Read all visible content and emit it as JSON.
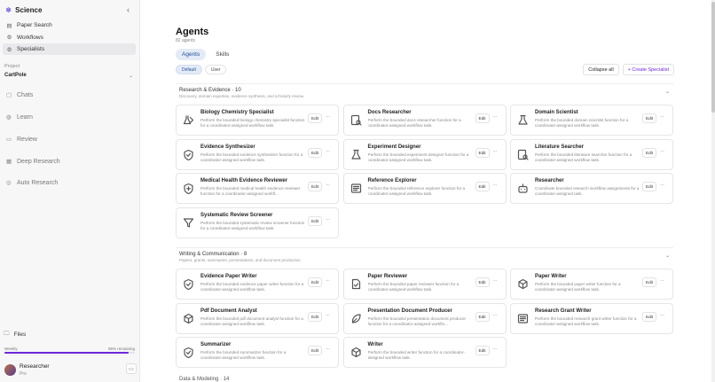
{
  "brand": {
    "name": "Science"
  },
  "nav": [
    {
      "label": "Paper Search",
      "icon": "document-icon"
    },
    {
      "label": "Workflows",
      "icon": "gear-icon"
    },
    {
      "label": "Specialists",
      "icon": "people-icon",
      "active": true
    }
  ],
  "project": {
    "label": "Project",
    "value": "CartPole"
  },
  "sections": [
    {
      "label": "Chats",
      "icon": "chat-icon"
    },
    {
      "label": "Learn",
      "icon": "learn-icon"
    },
    {
      "label": "Review",
      "icon": "review-icon"
    },
    {
      "label": "Deep Research",
      "icon": "layers-icon"
    },
    {
      "label": "Auto Research",
      "icon": "target-icon"
    }
  ],
  "files_label": "Files",
  "usage": {
    "label": "Weekly",
    "remaining": "95% remaining",
    "fraction": 0.95
  },
  "user": {
    "name": "Researcher",
    "plan": "Pro"
  },
  "page": {
    "title": "Agents",
    "count": "82 agents",
    "tabs": [
      "Agents",
      "Skills"
    ],
    "filters": [
      "Default",
      "User"
    ],
    "collapse_all": "Collapse all",
    "create": "+ Create Specialist"
  },
  "categories": [
    {
      "title": "Research & Evidence · 10",
      "desc": "Discovery, domain expertise, evidence synthesis, and scholarly review.",
      "agents": [
        {
          "name": "Biology Chemistry Specialist",
          "desc": "Perform the bounded biology chemistry specialist function for a coordinator-assigned workflow task.",
          "icon": "flask-pen-icon"
        },
        {
          "name": "Docs Researcher",
          "desc": "Perform the bounded docs researcher function for a coordinator-assigned workflow task.",
          "icon": "doc-search-icon"
        },
        {
          "name": "Domain Scientist",
          "desc": "Perform the bounded domain scientist function for a coordinator-assigned workflow task.",
          "icon": "flask-icon"
        },
        {
          "name": "Evidence Synthesizer",
          "desc": "Perform the bounded evidence synthesizer function for a coordinator-assigned workflow task.",
          "icon": "shield-check-icon"
        },
        {
          "name": "Experiment Designer",
          "desc": "Perform the bounded experiment designer function for a coordinator-assigned workflow task.",
          "icon": "flask-icon"
        },
        {
          "name": "Literature Searcher",
          "desc": "Perform the bounded literature searcher function for a coordinator-assigned workflow task.",
          "icon": "doc-search-icon"
        },
        {
          "name": "Medical Health Evidence Reviewer",
          "desc": "Perform the bounded medical health evidence reviewer function for a coordinator-assigned workfl...",
          "icon": "shield-plus-icon"
        },
        {
          "name": "Reference Explorer",
          "desc": "Perform the bounded reference explorer function for a coordinator-assigned workflow task.",
          "icon": "newspaper-icon"
        },
        {
          "name": "Researcher",
          "desc": "Coordinate bounded research workflow assignments for a coordinator-assigned task.",
          "icon": "robot-icon"
        },
        {
          "name": "Systematic Review Screener",
          "desc": "Perform the bounded systematic review screener function for a coordinator-assigned workflow task.",
          "icon": "funnel-icon"
        }
      ]
    },
    {
      "title": "Writing & Communication · 8",
      "desc": "Papers, grants, summaries, presentations, and document production.",
      "agents": [
        {
          "name": "Evidence Paper Writer",
          "desc": "Perform the bounded evidence paper writer function for a coordinator-assigned workflow task.",
          "icon": "shield-check-icon"
        },
        {
          "name": "Paper Reviewer",
          "desc": "Perform the bounded paper reviewer function for a coordinator-assigned workflow task.",
          "icon": "file-check-icon"
        },
        {
          "name": "Paper Writer",
          "desc": "Perform the bounded paper writer function for a coordinator-assigned workflow task.",
          "icon": "cube-icon"
        },
        {
          "name": "Pdf Document Analyst",
          "desc": "Perform the bounded pdf document analyst function for a coordinator-assigned workflow task.",
          "icon": "cube-icon"
        },
        {
          "name": "Presentation Document Producer",
          "desc": "Perform the bounded presentation document producer function for a coordinator-assigned workflo...",
          "icon": "leaf-icon"
        },
        {
          "name": "Research Grant Writer",
          "desc": "Perform the bounded research grant writer function for a coordinator-assigned workflow task.",
          "icon": "newspaper-icon"
        },
        {
          "name": "Summarizer",
          "desc": "Perform the bounded summarizer function for a coordinator-assigned workflow task.",
          "icon": "shield-check-icon"
        },
        {
          "name": "Writer",
          "desc": "Perform the bounded writer function for a coordinator-assigned workflow task.",
          "icon": "cube-icon"
        }
      ]
    }
  ],
  "next_category": "Data & Modeling · 14",
  "card_actions": {
    "edit": "Edit",
    "more": "···"
  }
}
